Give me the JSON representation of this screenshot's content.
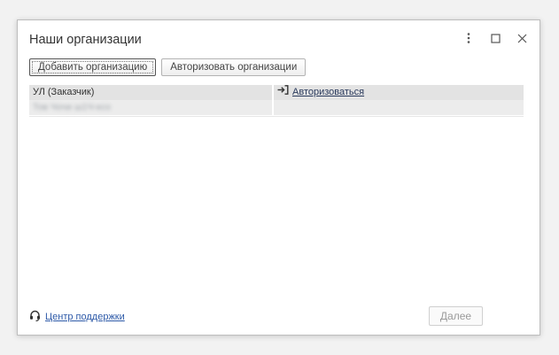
{
  "window": {
    "title": "Наши организации"
  },
  "toolbar": {
    "add_label": "Добавить организацию",
    "authorize_label": "Авторизовать организации"
  },
  "grid": {
    "columns": [
      "УЛ (Заказчик)",
      "Авторизоваться"
    ],
    "rows": [
      {
        "org": "Тов Чочи ш1Ч-ксо"
      }
    ]
  },
  "footer": {
    "support_label": "Центр поддержки",
    "next_label": "Далее"
  },
  "icons": {
    "more": "more-vertical-icon",
    "maximize": "maximize-icon",
    "close": "close-icon",
    "login": "login-arrow-icon",
    "support": "headset-icon"
  }
}
